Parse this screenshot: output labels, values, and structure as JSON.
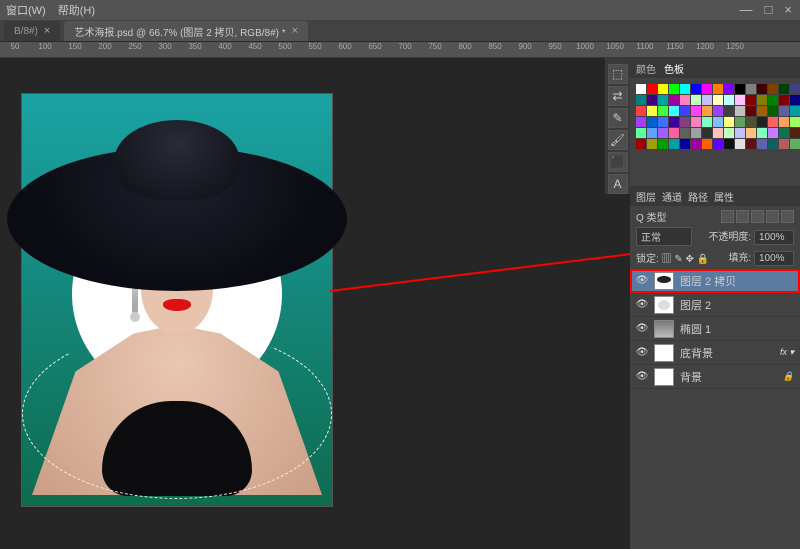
{
  "menu": {
    "window": "窗口(W)",
    "help": "帮助(H)"
  },
  "window_controls": {
    "min": "—",
    "max": "□",
    "close": "×"
  },
  "tabs": {
    "prev": "B/8#)",
    "active": "艺术海报.psd @ 66.7% (图层 2 拷贝, RGB/8#)  *"
  },
  "ruler": [
    "50",
    "100",
    "150",
    "200",
    "250",
    "300",
    "350",
    "400",
    "450",
    "500",
    "550",
    "600",
    "650",
    "700",
    "750",
    "800",
    "850",
    "900",
    "950",
    "1000",
    "1050",
    "1100",
    "1150",
    "1200",
    "1250"
  ],
  "right_panels": {
    "color_tab": "颜色",
    "swatches_tab": "色板"
  },
  "layers_panel": {
    "tab_layers": "图层",
    "tab_channels": "通道",
    "tab_paths": "路径",
    "tab_props": "属性",
    "kind_label": "Q 类型",
    "blend_mode": "正常",
    "opacity_label": "不透明度:",
    "opacity_value": "100%",
    "lock_label": "锁定:",
    "fill_label": "填充:",
    "fill_value": "100%"
  },
  "layers": [
    {
      "name": "图层 2 拷贝",
      "selected": true,
      "outlined": true,
      "thumb": "hat-t",
      "fx": ""
    },
    {
      "name": "图层 2",
      "selected": false,
      "outlined": false,
      "thumb": "circle-t",
      "fx": ""
    },
    {
      "name": "椭圆 1",
      "selected": false,
      "outlined": false,
      "thumb": "gray-t",
      "fx": ""
    },
    {
      "name": "底背景",
      "selected": false,
      "outlined": false,
      "thumb": "white-t",
      "fx": "fx ▾"
    },
    {
      "name": "背景",
      "selected": false,
      "outlined": false,
      "thumb": "white-t",
      "fx": "🔒"
    }
  ],
  "swatch_colors": [
    "#ffffff",
    "#ff0000",
    "#ffff00",
    "#00ff00",
    "#00ffff",
    "#0000ff",
    "#ff00ff",
    "#ff8000",
    "#8000ff",
    "#000000",
    "#808080",
    "#400000",
    "#804000",
    "#004000",
    "#404080",
    "#008080",
    "#400080",
    "#00a0a0",
    "#a000a0",
    "#ff80c0",
    "#c0ffc0",
    "#c0c0ff",
    "#ffffc0",
    "#c0ffff",
    "#ffc0ff",
    "#800000",
    "#808000",
    "#008000",
    "#800000",
    "#000080",
    "#ff4040",
    "#ffff40",
    "#40ff40",
    "#40ffff",
    "#4040ff",
    "#ff40ff",
    "#ffa040",
    "#a040ff",
    "#404040",
    "#c0c0c0",
    "#600000",
    "#a06000",
    "#006000",
    "#6060a0",
    "#00a0a0",
    "#a040ff",
    "#0060d0",
    "#4070ff",
    "#4000a0",
    "#804080",
    "#ff80c0",
    "#80ffc0",
    "#80c0ff",
    "#ffff80",
    "#60a060",
    "#505030",
    "#202020",
    "#ff6060",
    "#ffa060",
    "#a0ff60",
    "#60ffa0",
    "#60a0ff",
    "#a060ff",
    "#ff60a0",
    "#606060",
    "#a0a0a0",
    "#303030",
    "#ffc0c0",
    "#c0ffc0",
    "#c0c0ff",
    "#ffc080",
    "#80ffc0",
    "#c080ff",
    "#107050",
    "#502010",
    "#a00000",
    "#a0a000",
    "#00a000",
    "#00a0a0",
    "#0000a0",
    "#a000a0",
    "#ff6000",
    "#6000ff",
    "#101010",
    "#e0e0e0",
    "#601010",
    "#6060b0",
    "#106060",
    "#b06060",
    "#60b060"
  ],
  "vtoolbar_icons": [
    "⬚",
    "⇄",
    "✎",
    "🖌",
    "⬛",
    "A"
  ]
}
